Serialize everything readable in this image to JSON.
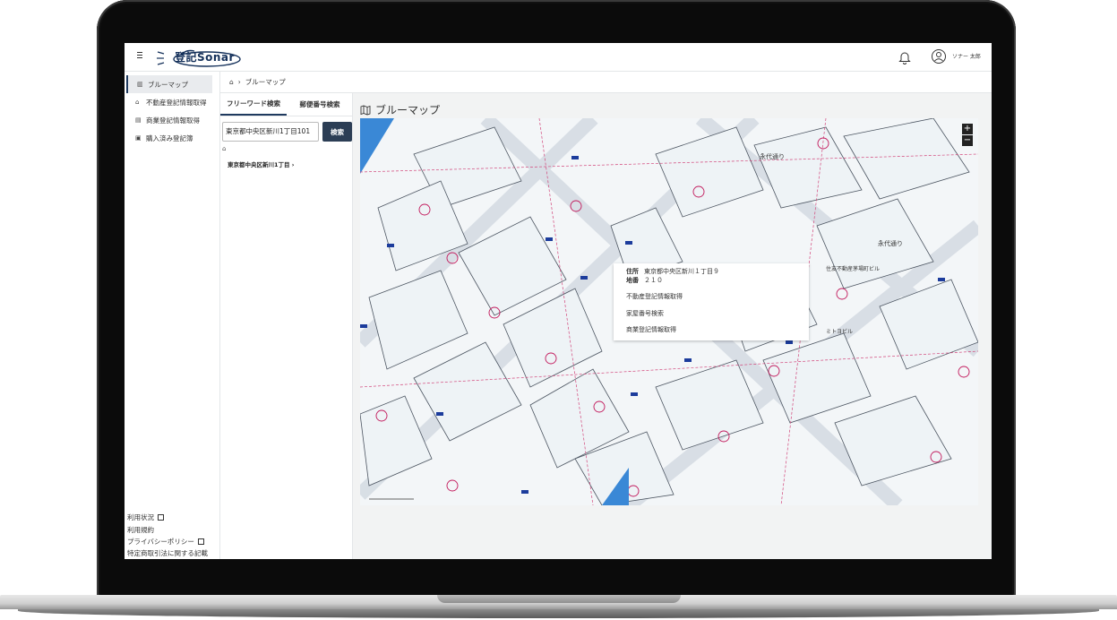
{
  "app": {
    "logo_text": "登記Sonar",
    "user_name": "ソナー 太郎"
  },
  "sidebar": {
    "items": [
      {
        "label": "ブルーマップ",
        "icon": "map-icon",
        "active": true
      },
      {
        "label": "不動産登記情報取得",
        "icon": "home-icon",
        "active": false
      },
      {
        "label": "商業登記情報取得",
        "icon": "building-icon",
        "active": false
      },
      {
        "label": "購入済み登記簿",
        "icon": "document-icon",
        "active": false
      }
    ],
    "footer": [
      {
        "label": "利用状況",
        "external": true
      },
      {
        "label": "利用規約",
        "external": false
      },
      {
        "label": "プライバシーポリシー",
        "external": true
      },
      {
        "label": "特定商取引法に関する記載",
        "external": false
      }
    ]
  },
  "breadcrumb": {
    "current": "ブルーマップ"
  },
  "search": {
    "tabs": [
      "フリーワード検索",
      "郵便番号検索"
    ],
    "input_value": "東京都中央区新川1丁目101",
    "button_label": "検索",
    "result": "東京都中央区新川1丁目 ›"
  },
  "map": {
    "title": "ブルーマップ",
    "zoom_in": "+",
    "zoom_out": "−",
    "popup": {
      "address_key": "住所",
      "address_value": "東京都中央区新川１丁目９",
      "lot_key": "地番",
      "lot_value": "２１０",
      "actions": [
        "不動産登記情報取得",
        "家屋番号検索",
        "商業登記情報取得"
      ]
    },
    "labels": [
      "永代通り",
      "永代通り",
      "ミトヨビル",
      "住友不動産茅場町ビル"
    ]
  }
}
